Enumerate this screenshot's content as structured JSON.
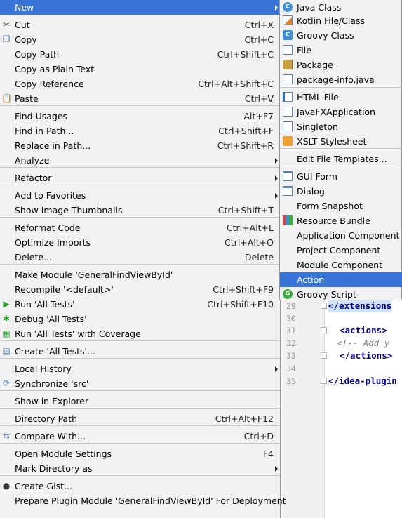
{
  "editor": {
    "lines": [
      {
        "num": "29",
        "code": "</extensions",
        "style": "hl"
      },
      {
        "num": "30",
        "code": "",
        "style": ""
      },
      {
        "num": "31",
        "code": "<actions>",
        "style": ""
      },
      {
        "num": "32",
        "code": "  <!-- Add y",
        "style": "cmt"
      },
      {
        "num": "33",
        "code": "</actions>",
        "style": ""
      },
      {
        "num": "34",
        "code": "",
        "style": ""
      },
      {
        "num": "35",
        "code": "</idea-plugin",
        "style": ""
      }
    ]
  },
  "menu": {
    "items": [
      {
        "label": "New",
        "shortcut": "",
        "submenu": true,
        "selected": true,
        "icon": ""
      },
      {
        "label": "Cut",
        "shortcut": "Ctrl+X",
        "icon": "scissors-icon"
      },
      {
        "label": "Copy",
        "shortcut": "Ctrl+C",
        "icon": "copy-icon"
      },
      {
        "label": "Copy Path",
        "shortcut": "Ctrl+Shift+C",
        "icon": ""
      },
      {
        "label": "Copy as Plain Text",
        "shortcut": "",
        "icon": ""
      },
      {
        "label": "Copy Reference",
        "shortcut": "Ctrl+Alt+Shift+C",
        "icon": ""
      },
      {
        "label": "Paste",
        "shortcut": "Ctrl+V",
        "icon": "paste-icon"
      },
      {
        "label": "Find Usages",
        "shortcut": "Alt+F7",
        "icon": ""
      },
      {
        "label": "Find in Path...",
        "shortcut": "Ctrl+Shift+F",
        "icon": ""
      },
      {
        "label": "Replace in Path...",
        "shortcut": "Ctrl+Shift+R",
        "icon": ""
      },
      {
        "label": "Analyze",
        "shortcut": "",
        "submenu": true,
        "icon": ""
      },
      {
        "label": "Refactor",
        "shortcut": "",
        "submenu": true,
        "icon": ""
      },
      {
        "label": "Add to Favorites",
        "shortcut": "",
        "submenu": true,
        "icon": ""
      },
      {
        "label": "Show Image Thumbnails",
        "shortcut": "Ctrl+Shift+T",
        "icon": ""
      },
      {
        "label": "Reformat Code",
        "shortcut": "Ctrl+Alt+L",
        "icon": ""
      },
      {
        "label": "Optimize Imports",
        "shortcut": "Ctrl+Alt+O",
        "icon": ""
      },
      {
        "label": "Delete...",
        "shortcut": "Delete",
        "icon": ""
      },
      {
        "label": "Make Module 'GeneralFindViewById'",
        "shortcut": "",
        "icon": ""
      },
      {
        "label": "Recompile '<default>'",
        "shortcut": "Ctrl+Shift+F9",
        "icon": ""
      },
      {
        "label": "Run 'All Tests'",
        "shortcut": "Ctrl+Shift+F10",
        "icon": "run-icon"
      },
      {
        "label": "Debug 'All Tests'",
        "shortcut": "",
        "icon": "debug-icon"
      },
      {
        "label": "Run 'All Tests' with Coverage",
        "shortcut": "",
        "icon": "coverage-icon"
      },
      {
        "label": "Create 'All Tests'...",
        "shortcut": "",
        "icon": "create-test-icon"
      },
      {
        "label": "Local History",
        "shortcut": "",
        "submenu": true,
        "icon": ""
      },
      {
        "label": "Synchronize 'src'",
        "shortcut": "",
        "icon": "sync-icon"
      },
      {
        "label": "Show in Explorer",
        "shortcut": "",
        "icon": ""
      },
      {
        "label": "Directory Path",
        "shortcut": "Ctrl+Alt+F12",
        "icon": ""
      },
      {
        "label": "Compare With...",
        "shortcut": "Ctrl+D",
        "icon": "compare-icon"
      },
      {
        "label": "Open Module Settings",
        "shortcut": "F4",
        "icon": ""
      },
      {
        "label": "Mark Directory as",
        "shortcut": "",
        "submenu": true,
        "icon": ""
      },
      {
        "label": "Create Gist...",
        "shortcut": "",
        "icon": "github-icon"
      },
      {
        "label": "Prepare Plugin Module 'GeneralFindViewById' For Deployment",
        "shortcut": "",
        "icon": ""
      }
    ]
  },
  "submenu": {
    "items": [
      {
        "label": "Java Class",
        "icon": "java-class-icon",
        "badge": "C"
      },
      {
        "label": "Kotlin File/Class",
        "icon": "kotlin-file-icon",
        "badge": ""
      },
      {
        "label": "Groovy Class",
        "icon": "groovy-class-icon",
        "badge": "C"
      },
      {
        "label": "File",
        "icon": "file-icon",
        "badge": ""
      },
      {
        "label": "Package",
        "icon": "package-icon",
        "badge": ""
      },
      {
        "label": "package-info.java",
        "icon": "java-file-icon",
        "badge": ""
      },
      {
        "label": "HTML File",
        "icon": "html-file-icon",
        "badge": ""
      },
      {
        "label": "JavaFXApplication",
        "icon": "javafx-icon",
        "badge": ""
      },
      {
        "label": "Singleton",
        "icon": "singleton-icon",
        "badge": ""
      },
      {
        "label": "XSLT Stylesheet",
        "icon": "xslt-icon",
        "badge": ""
      },
      {
        "label": "Edit File Templates...",
        "icon": "",
        "badge": ""
      },
      {
        "label": "GUI Form",
        "icon": "gui-form-icon",
        "badge": ""
      },
      {
        "label": "Dialog",
        "icon": "dialog-icon",
        "badge": ""
      },
      {
        "label": "Form Snapshot",
        "icon": "",
        "badge": ""
      },
      {
        "label": "Resource Bundle",
        "icon": "resource-bundle-icon",
        "badge": ""
      },
      {
        "label": "Application Component",
        "icon": "",
        "badge": ""
      },
      {
        "label": "Project Component",
        "icon": "",
        "badge": ""
      },
      {
        "label": "Module Component",
        "icon": "",
        "badge": ""
      },
      {
        "label": "Action",
        "icon": "",
        "badge": "",
        "selected": true
      },
      {
        "label": "Groovy Script",
        "icon": "groovy-script-icon",
        "badge": "G"
      }
    ]
  }
}
